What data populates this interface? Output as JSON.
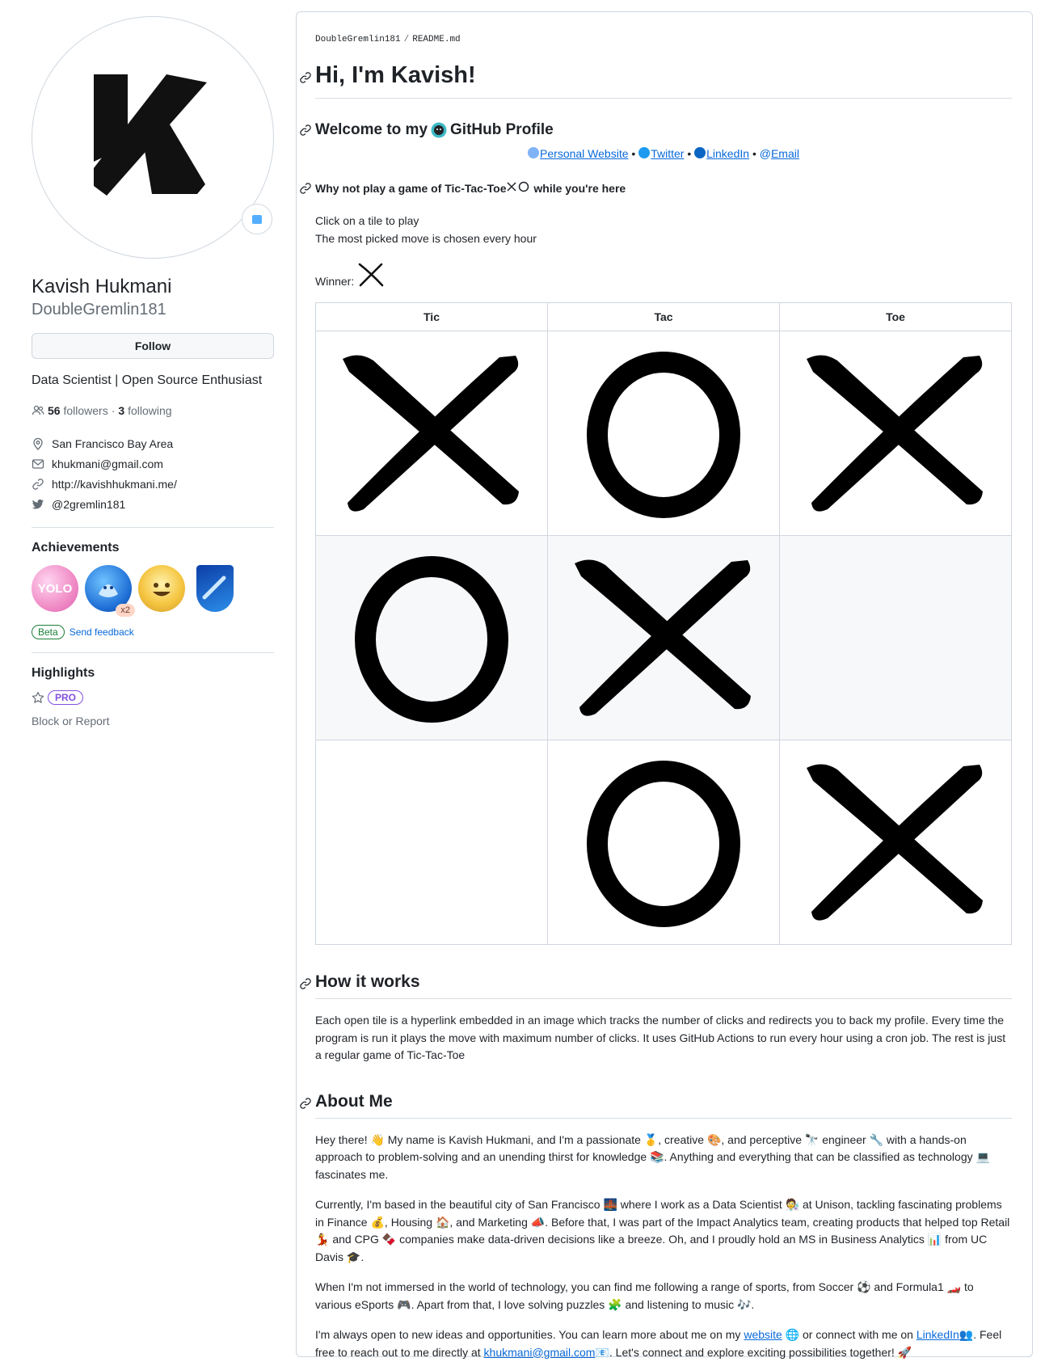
{
  "profile": {
    "fullname": "Kavish Hukmani",
    "username": "DoubleGremlin181",
    "follow_label": "Follow",
    "bio": "Data Scientist | Open Source Enthusiast",
    "followers_count": "56",
    "followers_label": "followers",
    "following_sep": "·",
    "following_count": "3",
    "following_label": "following",
    "location": "San Francisco Bay Area",
    "email": "khukmani@gmail.com",
    "website": "http://kavishhukmani.me/",
    "twitter": "@2gremlin181",
    "achievements_heading": "Achievements",
    "achievements": [
      {
        "name": "yolo",
        "label": "YOLO"
      },
      {
        "name": "pull-shark",
        "multiplier": "x2"
      },
      {
        "name": "quickdraw"
      },
      {
        "name": "arctic-code-vault"
      }
    ],
    "beta_label": "Beta",
    "feedback_label": "Send feedback",
    "highlights_heading": "Highlights",
    "pro_label": "PRO",
    "block_label": "Block or Report"
  },
  "readme": {
    "breadcrumb_user": "DoubleGremlin181",
    "breadcrumb_sep": "/",
    "breadcrumb_file": "README.md",
    "title": "Hi, I'm Kavish!",
    "welcome_before": "Welcome to my",
    "welcome_after": "GitHub Profile",
    "links": {
      "website": "Personal Website",
      "twitter": "Twitter",
      "linkedin": "LinkedIn",
      "email": "Email",
      "sep": "•"
    },
    "ttt_heading_before": "Why not play a game of Tic-Tac-Toe",
    "ttt_heading_after": "while you're here",
    "click_line": "Click on a tile to play",
    "hour_line": "The most picked move is chosen every hour",
    "winner_label": "Winner:",
    "winner_value": "X",
    "board_headers": [
      "Tic",
      "Tac",
      "Toe"
    ],
    "board": [
      [
        "X",
        "O",
        "X"
      ],
      [
        "O",
        "X",
        ""
      ],
      [
        "",
        "O",
        "X"
      ]
    ],
    "how_heading": "How it works",
    "how_text": "Each open tile is a hyperlink embedded in an image which tracks the number of clicks and redirects you to back my profile. Every time the program is run it plays the move with maximum number of clicks. It uses GitHub Actions to run every hour using a cron job. The rest is just a regular game of Tic-Tac-Toe",
    "about_heading": "About Me",
    "about_p1": "Hey there! 👋 My name is Kavish Hukmani, and I'm a passionate 🥇, creative 🎨, and perceptive 🔭 engineer 🔧 with a hands-on approach to problem-solving and an unending thirst for knowledge 📚. Anything and everything that can be classified as technology 💻 fascinates me.",
    "about_p2": "Currently, I'm based in the beautiful city of San Francisco 🌉 where I work as a Data Scientist 🧑‍🔬 at Unison, tackling fascinating problems in Finance 💰, Housing 🏠, and Marketing 📣. Before that, I was part of the Impact Analytics team, creating products that helped top Retail 💃 and CPG 🍫 companies make data-driven decisions like a breeze. Oh, and I proudly hold an MS in Business Analytics 📊 from UC Davis 🎓.",
    "about_p3": "When I'm not immersed in the world of technology, you can find me following a range of sports, from Soccer ⚽ and Formula1 🏎️ to various eSports 🎮. Apart from that, I love solving puzzles 🧩 and listening to music 🎶.",
    "about_p4_a": "I'm always open to new ideas and opportunities. You can learn more about me on my",
    "about_p4_website": "website",
    "about_p4_b": "🌐 or connect with me on",
    "about_p4_linkedin": "LinkedIn",
    "about_p4_c": "👥. Feel free to reach out to me directly at",
    "about_p4_email": "khukmani@gmail.com",
    "about_p4_d": "📧. Let's connect and explore exciting possibilities together! 🚀"
  },
  "colors": {
    "link": "#0969da",
    "muted": "#656d76",
    "border": "#d0d7de",
    "beta": "#1a7f37",
    "pro": "#8250df"
  }
}
